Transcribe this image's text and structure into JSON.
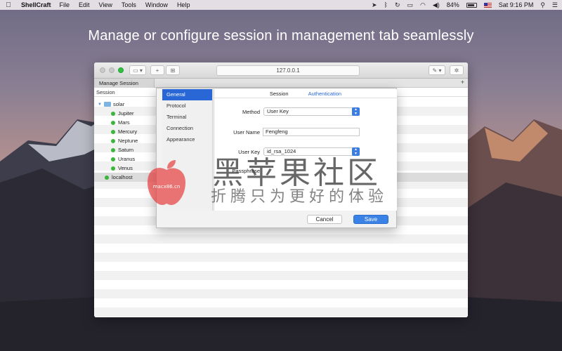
{
  "menubar": {
    "app_name": "ShellCraft",
    "items": [
      "File",
      "Edit",
      "View",
      "Tools",
      "Window",
      "Help"
    ],
    "battery": "84%",
    "clock": "Sat 9:16 PM"
  },
  "headline": "Manage or configure session in management tab seamlessly",
  "window": {
    "url": "127.0.0.1",
    "tab_label": "Manage Session",
    "add_tab": "+",
    "session_header": "Session",
    "tree": {
      "folder": "solar",
      "children": [
        "Jupiter",
        "Mars",
        "Mercury",
        "Neptune",
        "Saturn",
        "Uranus",
        "Venus"
      ],
      "host": "localhost"
    }
  },
  "dialog": {
    "sidebar": [
      "General",
      "Protocol",
      "Terminal",
      "Connection",
      "Appearance"
    ],
    "tabs": [
      "Session",
      "Authentication"
    ],
    "method_label": "Method",
    "method_value": "User Key",
    "username_label": "User Name",
    "username_value": "Fengfeng",
    "userkey_label": "User Key",
    "userkey_value": "id_rsa_1024",
    "passphrase_label": "Passphrase",
    "cancel": "Cancel",
    "save": "Save"
  },
  "watermark": {
    "title": "黑苹果社区",
    "subtitle": "折腾只为更好的体验",
    "logo_text": "macx86.cn"
  },
  "colors": {
    "accent": "#2a67d6",
    "save_button": "#3b82e6",
    "online_dot": "#3bb53b"
  }
}
